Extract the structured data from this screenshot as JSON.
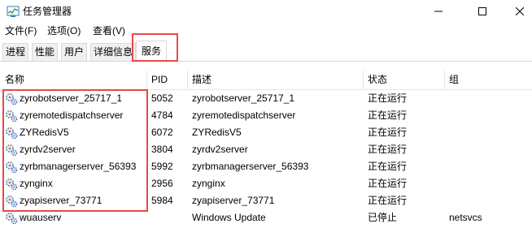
{
  "window": {
    "title": "任务管理器",
    "icon": "task-manager-icon"
  },
  "menu": [
    "文件(F)",
    "选项(O)",
    "查看(V)"
  ],
  "tabs": [
    "进程",
    "性能",
    "用户",
    "详细信息",
    "服务"
  ],
  "active_tab": "服务",
  "columns": {
    "name": "名称",
    "pid": "PID",
    "desc": "描述",
    "status": "状态",
    "group": "组"
  },
  "rows": [
    {
      "name": "zyrobotserver_25717_1",
      "pid": "5052",
      "desc": "zyrobotserver_25717_1",
      "status": "正在运行",
      "group": ""
    },
    {
      "name": "zyremotedispatchserver",
      "pid": "4784",
      "desc": "zyremotedispatchserver",
      "status": "正在运行",
      "group": ""
    },
    {
      "name": "ZYRedisV5",
      "pid": "6072",
      "desc": "ZYRedisV5",
      "status": "正在运行",
      "group": ""
    },
    {
      "name": "zyrdv2server",
      "pid": "3804",
      "desc": "zyrdv2server",
      "status": "正在运行",
      "group": ""
    },
    {
      "name": "zyrbmanagerserver_56393",
      "pid": "5992",
      "desc": "zyrbmanagerserver_56393",
      "status": "正在运行",
      "group": ""
    },
    {
      "name": "zynginx",
      "pid": "2956",
      "desc": "zynginx",
      "status": "正在运行",
      "group": ""
    },
    {
      "name": "zyapiserver_73771",
      "pid": "5984",
      "desc": "zyapiserver_73771",
      "status": "正在运行",
      "group": ""
    },
    {
      "name": "wuauserv",
      "pid": "",
      "desc": "Windows Update",
      "status": "已停止",
      "group": "netsvcs"
    }
  ],
  "colors": {
    "highlight": "#e8484a",
    "tab_border": "#d9d9d9",
    "header_sep": "#e5e5e5"
  }
}
